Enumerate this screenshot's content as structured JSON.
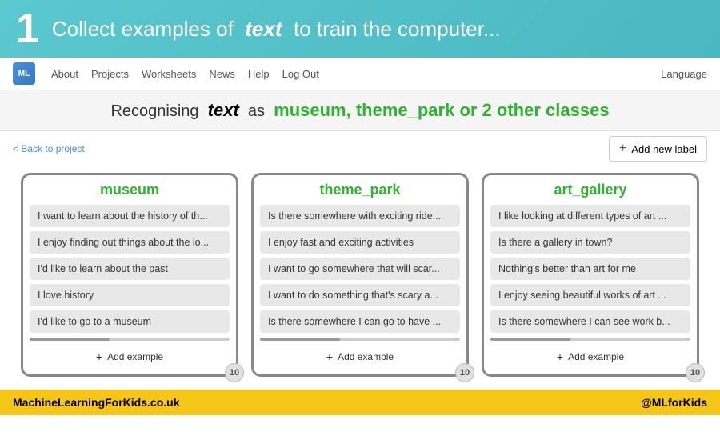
{
  "banner": {
    "number": "1",
    "prefix": "Collect examples of",
    "bold_word": "text",
    "suffix": "to train the computer..."
  },
  "navbar": {
    "about": "About",
    "projects": "Projects",
    "worksheets": "Worksheets",
    "news": "News",
    "help": "Help",
    "logout": "Log Out",
    "language": "Language"
  },
  "subheader": {
    "prefix": "Recognising",
    "bold_word": "text",
    "as_word": "as",
    "classes": "museum, theme_park or 2 other classes"
  },
  "back_link": "< Back to project",
  "add_label_btn": "Add new label",
  "cards": [
    {
      "title": "museum",
      "items": [
        "I want to learn about the history of th...",
        "I enjoy finding out things about the lo...",
        "I'd like to learn about the past",
        "I love history",
        "I'd like to go to a museum"
      ],
      "add_label": "Add example",
      "badge": "10"
    },
    {
      "title": "theme_park",
      "items": [
        "Is there somewhere with exciting ride...",
        "I enjoy fast and exciting activities",
        "I want to go somewhere that will scar...",
        "I want to do something that's scary a...",
        "Is there somewhere I can go to have ..."
      ],
      "add_label": "Add example",
      "badge": "10"
    },
    {
      "title": "art_gallery",
      "items": [
        "I like looking at different types of art ...",
        "Is there a gallery in town?",
        "Nothing's better than art for me",
        "I enjoy seeing beautiful works of art ...",
        "Is there somewhere I can see work b..."
      ],
      "add_label": "Add example",
      "badge": "10"
    }
  ],
  "footer": {
    "left": "MachineLearningForKids.co.uk",
    "right": "@MLforKids"
  }
}
